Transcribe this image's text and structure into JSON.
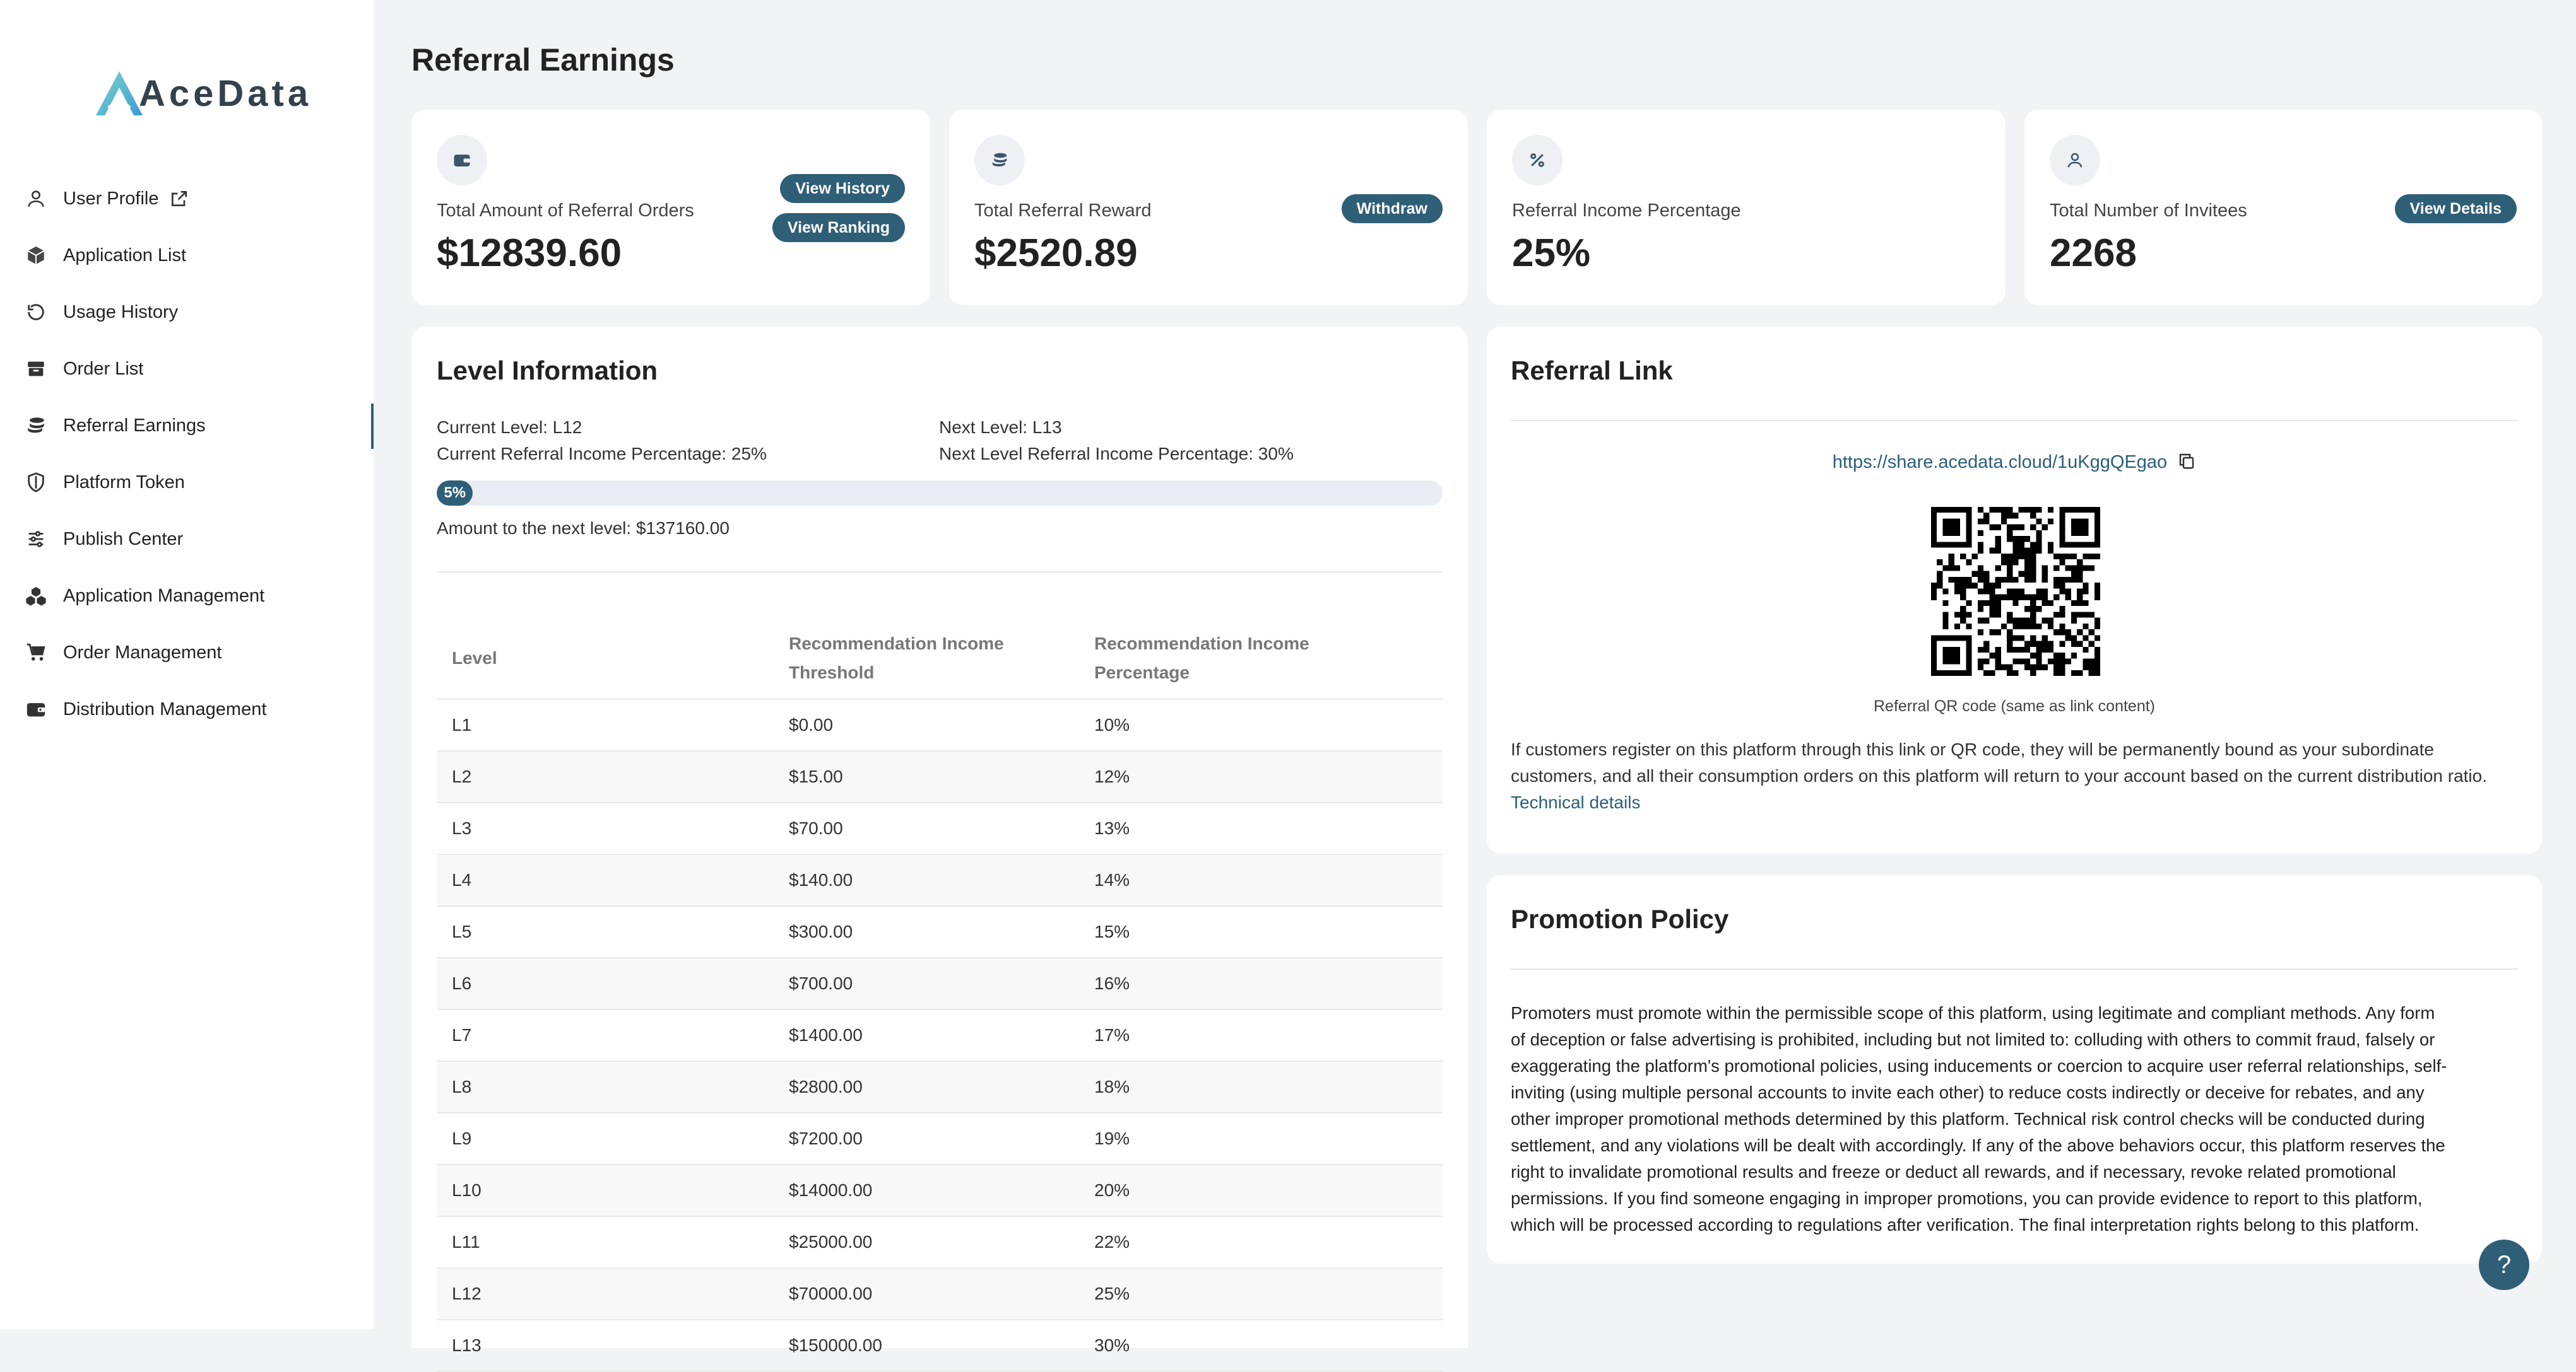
{
  "brand": {
    "logo_text": "AceData",
    "accent": "#2f5e77",
    "logo_accent": "#45c0d6"
  },
  "sidebar": {
    "items": [
      {
        "label": "User Profile",
        "icon": "user-icon",
        "external": true
      },
      {
        "label": "Application List",
        "icon": "cube-icon"
      },
      {
        "label": "Usage History",
        "icon": "history-icon"
      },
      {
        "label": "Order List",
        "icon": "box-icon"
      },
      {
        "label": "Referral Earnings",
        "icon": "coins-icon",
        "active": true
      },
      {
        "label": "Platform Token",
        "icon": "shield-icon"
      },
      {
        "label": "Publish Center",
        "icon": "sliders-icon"
      },
      {
        "label": "Application Management",
        "icon": "cubes-icon"
      },
      {
        "label": "Order Management",
        "icon": "cart-icon"
      },
      {
        "label": "Distribution Management",
        "icon": "wallet-icon"
      }
    ]
  },
  "page": {
    "title": "Referral Earnings"
  },
  "stats": [
    {
      "label": "Total Amount of Referral Orders",
      "value": "$12839.60",
      "icon": "wallet-icon",
      "buttons": [
        "View History",
        "View Ranking"
      ]
    },
    {
      "label": "Total Referral Reward",
      "value": "$2520.89",
      "icon": "coins-icon",
      "buttons": [
        "Withdraw"
      ]
    },
    {
      "label": "Referral Income Percentage",
      "value": "25%",
      "icon": "percent-icon",
      "buttons": []
    },
    {
      "label": "Total Number of Invitees",
      "value": "2268",
      "icon": "user-icon",
      "buttons": [
        "View Details"
      ]
    }
  ],
  "level_info": {
    "title": "Level Information",
    "current_level": "Current Level: L12",
    "next_level": "Next Level: L13",
    "current_pct": "Current Referral Income Percentage: 25%",
    "next_pct": "Next Level Referral Income Percentage: 30%",
    "progress_label": "5%",
    "progress_value": 0.036,
    "amount_to_next": "Amount to the next level: $137160.00",
    "table": {
      "headers": [
        "Level",
        "Recommendation Income Threshold",
        "Recommendation Income Percentage"
      ],
      "rows": [
        [
          "L1",
          "$0.00",
          "10%"
        ],
        [
          "L2",
          "$15.00",
          "12%"
        ],
        [
          "L3",
          "$70.00",
          "13%"
        ],
        [
          "L4",
          "$140.00",
          "14%"
        ],
        [
          "L5",
          "$300.00",
          "15%"
        ],
        [
          "L6",
          "$700.00",
          "16%"
        ],
        [
          "L7",
          "$1400.00",
          "17%"
        ],
        [
          "L8",
          "$2800.00",
          "18%"
        ],
        [
          "L9",
          "$7200.00",
          "19%"
        ],
        [
          "L10",
          "$14000.00",
          "20%"
        ],
        [
          "L11",
          "$25000.00",
          "22%"
        ],
        [
          "L12",
          "$70000.00",
          "25%"
        ],
        [
          "L13",
          "$150000.00",
          "30%"
        ]
      ]
    }
  },
  "referral_link": {
    "title": "Referral Link",
    "url": "https://share.acedata.cloud/1uKggQEgao",
    "qr_caption": "Referral QR code (same as link content)",
    "description": "If customers register on this platform through this link or QR code, they will be permanently bound as your subordinate customers, and all their consumption orders on this platform will return to your account based on the current distribution ratio.",
    "details_link": "Technical details"
  },
  "promotion": {
    "title": "Promotion Policy",
    "lines": [
      "Promoters must promote within the permissible scope of this platform, using legitimate and compliant methods. Any form",
      "of deception or false advertising is prohibited, including but not limited to: colluding with others to commit fraud, falsely or",
      "exaggerating the platform's promotional policies, using inducements or coercion to acquire user referral relationships, self-",
      "inviting (using multiple personal accounts to invite each other) to reduce costs indirectly or deceive for rebates, and any",
      "other improper promotional methods determined by this platform. Technical risk control checks will be conducted during",
      "settlement, and any violations will be dealt with accordingly. If any of the above behaviors occur, this platform reserves the",
      "right to invalidate promotional results and freeze or deduct all rewards, and if necessary, revoke related promotional",
      "permissions. If you find someone engaging in improper promotions, you can provide evidence to report to this platform,",
      "which will be processed according to regulations after verification. The final interpretation rights belong to this platform."
    ]
  },
  "help": {
    "label": "?"
  }
}
